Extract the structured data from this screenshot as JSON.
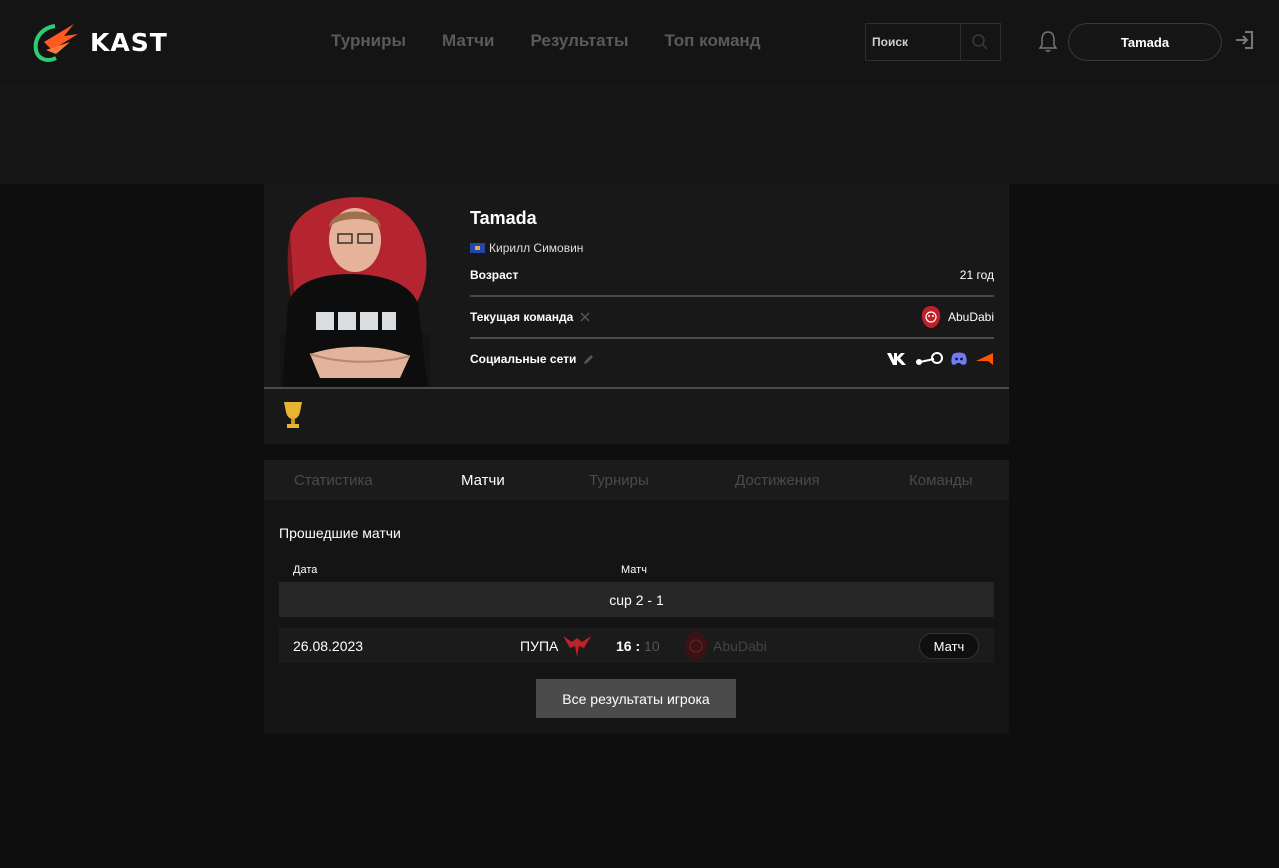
{
  "header": {
    "logo_text": "KAST",
    "nav": [
      "Турниры",
      "Матчи",
      "Результаты",
      "Топ команд"
    ],
    "search_placeholder": "Поиск",
    "username": "Tamada"
  },
  "profile": {
    "nickname": "Tamada",
    "real_name": "Кирилл Симовин",
    "age_label": "Возраст",
    "age_value": "21 год",
    "team_label": "Текущая команда",
    "team_name": "AbuDabi",
    "social_label": "Социальные сети",
    "socials": [
      "vk-icon",
      "steam-icon",
      "discord-icon",
      "faceit-icon"
    ]
  },
  "tabs": [
    "Статистика",
    "Матчи",
    "Турниры",
    "Достижения",
    "Команды"
  ],
  "active_tab": "Матчи",
  "matches": {
    "section_title": "Прошедшие матчи",
    "col_date": "Дата",
    "col_match": "Матч",
    "group": "cup 2 - 1",
    "rows": [
      {
        "date": "26.08.2023",
        "team1": "ПУПА",
        "score1": "16",
        "sep": ":",
        "score2": "10",
        "team2": "AbuDabi",
        "button": "Матч"
      }
    ],
    "all_results_label": "Все результаты игрока"
  },
  "colors": {
    "accent_green": "#2ecc71",
    "accent_orange": "#ff5a1f",
    "team_red": "#c0202a"
  }
}
